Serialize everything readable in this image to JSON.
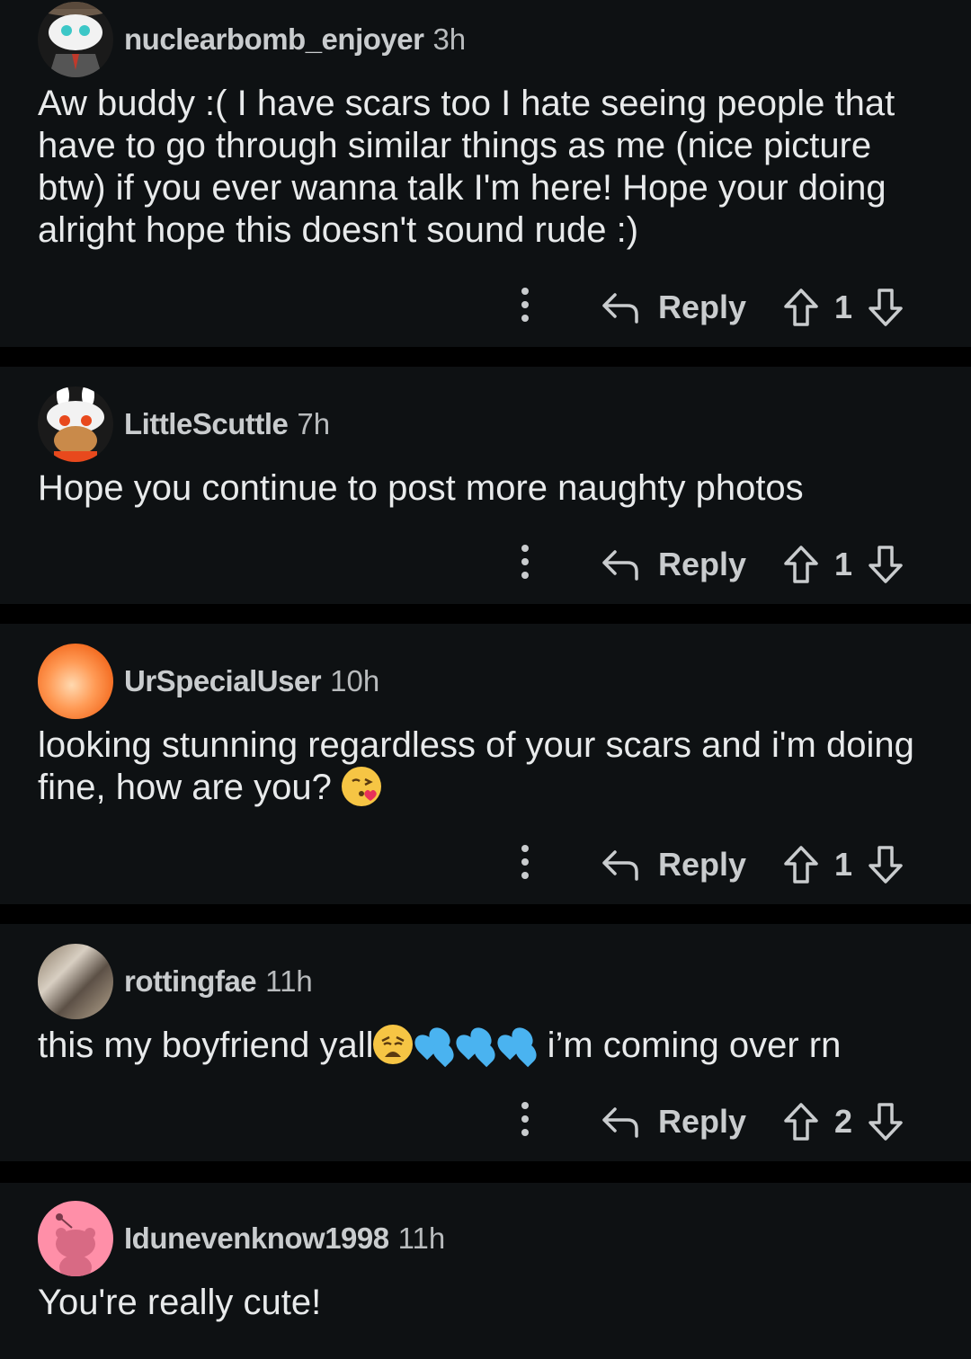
{
  "comments": [
    {
      "username": "nuclearbomb_enjoyer",
      "time": "3h",
      "text": "Aw buddy :( I have scars too I hate seeing people that have to go through similar things as me (nice picture btw) if you ever wanna talk I'm here! Hope your doing alright hope this doesn't sound rude :)",
      "reply_label": "Reply",
      "score": "1",
      "avatar_icon": "snoo-fedora-avatar"
    },
    {
      "username": "LittleScuttle",
      "time": "7h",
      "text": "Hope you continue to post more naughty photos",
      "reply_label": "Reply",
      "score": "1",
      "avatar_icon": "snoo-bunny-hat-avatar"
    },
    {
      "username": "UrSpecialUser",
      "time": "10h",
      "text_part1": "looking stunning regardless of your scars and i'm doing fine, how are you?",
      "emoji": "face-blowing-kiss",
      "reply_label": "Reply",
      "score": "1",
      "avatar_icon": "orange-photo-avatar"
    },
    {
      "username": "rottingfae",
      "time": "11h",
      "text_part1": "this my boyfriend yall",
      "emojis": [
        "weary-face",
        "sweat-droplets",
        "sweat-droplets",
        "sweat-droplets"
      ],
      "text_part2": " i’m coming over rn",
      "reply_label": "Reply",
      "score": "2",
      "avatar_icon": "photo-avatar"
    },
    {
      "username": "Idunevenknow1998",
      "time": "11h",
      "text": "You're really cute!",
      "avatar_icon": "default-snoo-pink-avatar"
    }
  ],
  "colors": {
    "background": "#000000",
    "card": "#0e1113",
    "text": "#e8eaeb",
    "muted": "#c9ccce"
  }
}
